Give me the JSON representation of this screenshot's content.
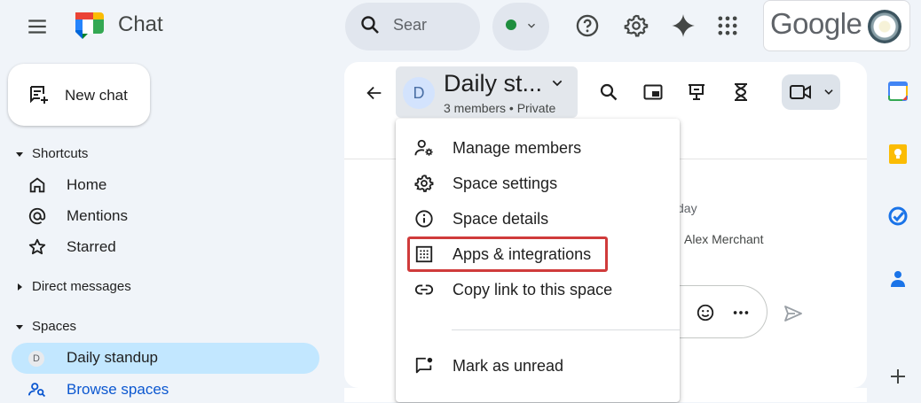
{
  "app": {
    "title": "Chat"
  },
  "search": {
    "placeholder": "Search"
  },
  "account": {
    "google_label": "Google"
  },
  "colors": {
    "accent": "#0b57d0",
    "active_bg": "#c2e7ff",
    "status_green": "#1e8e3e",
    "highlight": "#d03b3b"
  },
  "sidebar": {
    "new_chat_label": "New chat",
    "shortcuts_label": "Shortcuts",
    "shortcuts": [
      {
        "label": "Home",
        "icon": "home-icon"
      },
      {
        "label": "Mentions",
        "icon": "at-icon"
      },
      {
        "label": "Starred",
        "icon": "star-icon"
      }
    ],
    "direct_messages_label": "Direct messages",
    "spaces_label": "Spaces",
    "spaces": [
      {
        "label": "Daily standup",
        "avatar": "D"
      },
      {
        "label": "Browse spaces"
      }
    ]
  },
  "space": {
    "avatar": "D",
    "title": "Daily st...",
    "subtitle": "3 members  •  Private"
  },
  "background": {
    "day_text": "day",
    "sender": "Alex Merchant"
  },
  "menu": {
    "items": [
      {
        "label": "Manage members",
        "icon": "manage-members-icon"
      },
      {
        "label": "Space settings",
        "icon": "gear-icon"
      },
      {
        "label": "Space details",
        "icon": "info-icon"
      },
      {
        "label": "Apps & integrations",
        "icon": "apps-grid-icon"
      },
      {
        "label": "Copy link to this space",
        "icon": "link-icon"
      },
      {
        "label": "Mark as unread",
        "icon": "mark-unread-icon"
      }
    ],
    "highlighted_item": "Apps & integrations"
  }
}
